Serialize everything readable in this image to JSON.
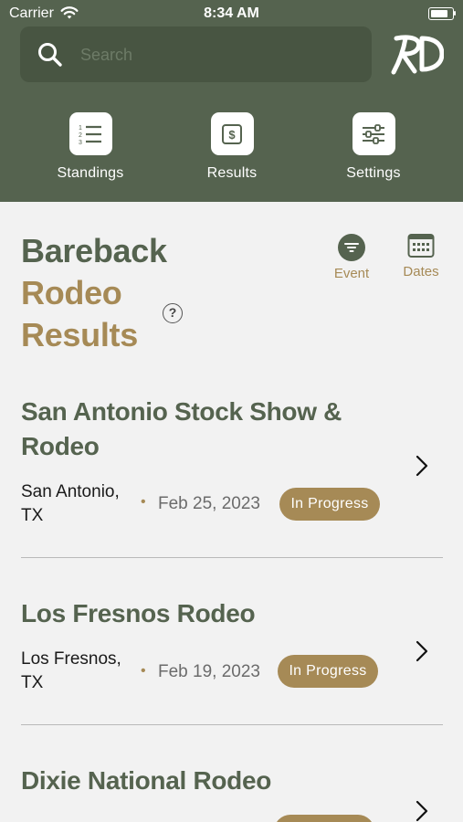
{
  "status_bar": {
    "carrier": "Carrier",
    "time": "8:34 AM"
  },
  "header": {
    "search": {
      "placeholder": "Search",
      "value": ""
    },
    "logo_text": "RD",
    "nav": [
      {
        "label": "Standings",
        "icon": "list-icon"
      },
      {
        "label": "Results",
        "icon": "dollar-icon"
      },
      {
        "label": "Settings",
        "icon": "sliders-icon"
      }
    ]
  },
  "page": {
    "title_line1": "Bareback",
    "title_line2": "Rodeo",
    "title_line3": "Results",
    "help": "?",
    "filters": [
      {
        "label": "Event",
        "icon": "filter-icon"
      },
      {
        "label": "Dates",
        "icon": "calendar-icon"
      }
    ]
  },
  "rodeos": [
    {
      "name": "San Antonio Stock Show & Rodeo",
      "city": "San Antonio, TX",
      "date": "Feb 25, 2023",
      "status": "In Progress"
    },
    {
      "name": "Los Fresnos Rodeo",
      "city": "Los Fresnos, TX",
      "date": "Feb 19, 2023",
      "status": "In Progress"
    },
    {
      "name": "Dixie National Rodeo",
      "city": "",
      "date": "",
      "status": ""
    }
  ],
  "colors": {
    "header_bg": "#55634f",
    "accent_gold": "#a68a56",
    "title_green": "#55634f",
    "background": "#f2f2f2"
  }
}
